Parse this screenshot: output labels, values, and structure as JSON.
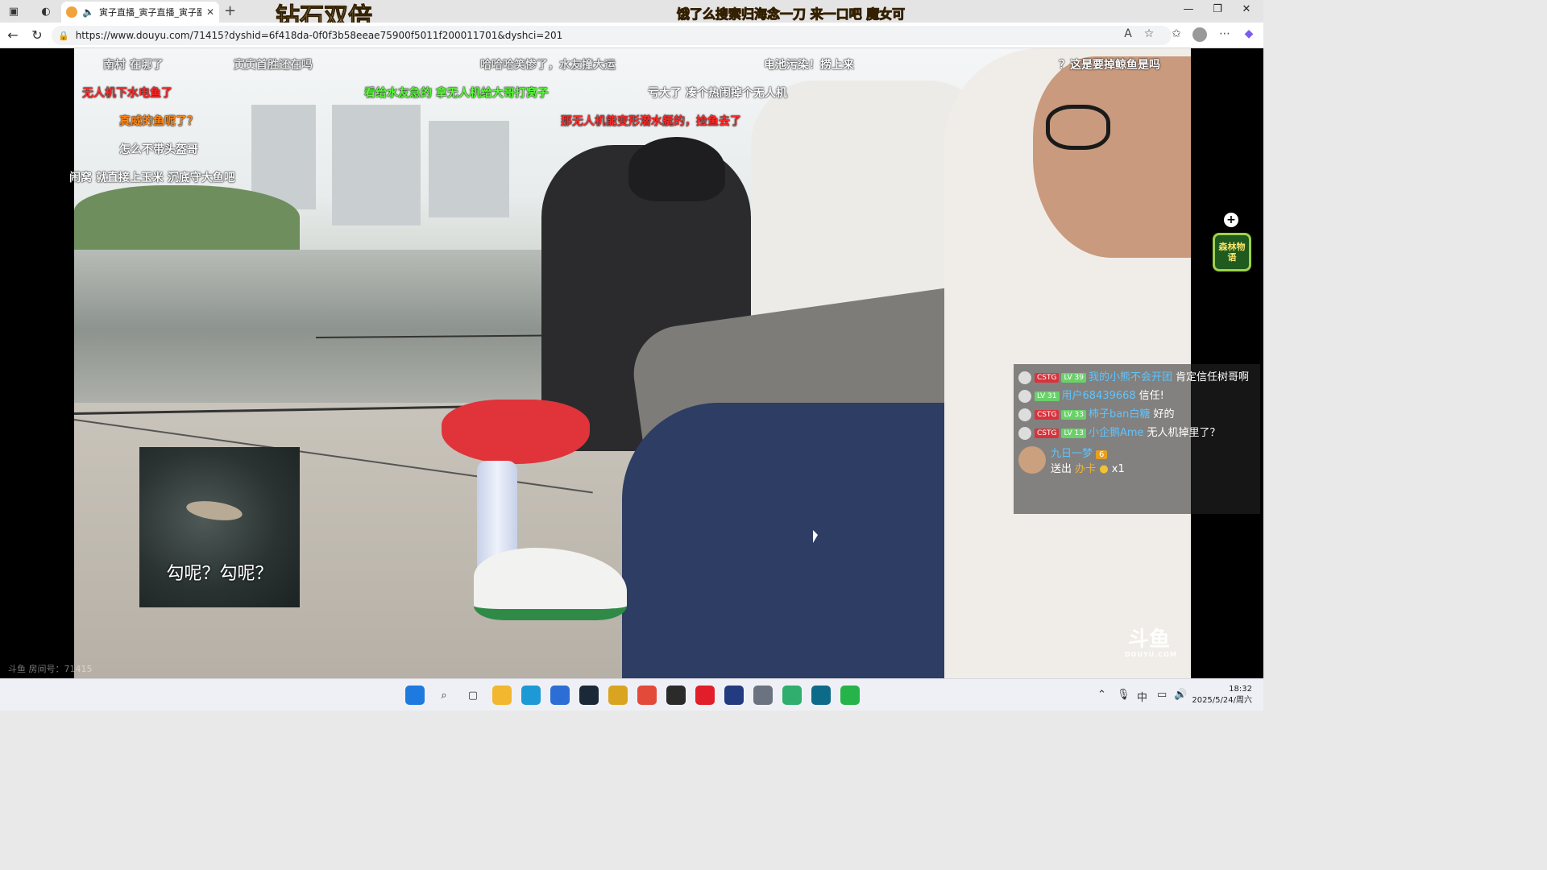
{
  "browser": {
    "tab_title": "寅子直播_寅子直播_寅子鄙",
    "url": "https://www.douyu.com/71415?dyshid=6f418da-0f0f3b58eeae75900f5011f200011701&dyshci=201",
    "overlay_left": "钻石双倍",
    "overlay_right": "饿了么搜索归海念一刀 来一口吧 魔女可"
  },
  "danmaku": [
    {
      "text": "南村 在哪了",
      "color": "#e8e8e8"
    },
    {
      "text": "寅寅首胜还在吗",
      "color": "#e8e8e8"
    },
    {
      "text": "哈哈哈笑惨了，水友撞大运",
      "color": "#e8e8e8"
    },
    {
      "text": "电池污染！捞上来",
      "color": "#ffffff"
    },
    {
      "text": "？这是要掉鲸鱼是吗",
      "color": "#ffffff"
    },
    {
      "text": "无人机下水电鱼了",
      "color": "#ff2a2a"
    },
    {
      "text": "看给水友急的 拿无人机给大哥打窝子",
      "color": "#5cff3a"
    },
    {
      "text": "亏大了 凑个热闹掉个无人机",
      "color": "#ffffff"
    },
    {
      "text": "真威的鱼呢了？",
      "color": "#ff8a1a"
    },
    {
      "text": "那无人机能变形潜水艇的，捡鱼去了",
      "color": "#ff2a2a"
    },
    {
      "text": "怎么不带头盔哥",
      "color": "#ffffff"
    },
    {
      "text": "闹窝 就直接上玉米 沉底守大鱼吧",
      "color": "#ffffff"
    }
  ],
  "inset_caption": "勾呢？勾呢？",
  "forest_badge": "森林物语",
  "chat": {
    "messages": [
      {
        "badges": [
          "CSTG",
          "LV 39"
        ],
        "user": "我的小熊不会开团",
        "text": "肯定信任树哥啊"
      },
      {
        "badges": [
          "LV 31"
        ],
        "user": "用户68439668",
        "text": "信任!"
      },
      {
        "badges": [
          "CSTG",
          "LV 33"
        ],
        "user": "柿子ban白糖",
        "text": "好的"
      },
      {
        "badges": [
          "CSTG",
          "LV 13"
        ],
        "user": "小企鹅Ame",
        "text": "无人机掉里了？"
      }
    ],
    "gift": {
      "user": "九日一梦",
      "level": "6",
      "prefix": "送出",
      "item": "办卡",
      "count": "x1"
    }
  },
  "player": {
    "watermark_big": "斗鱼",
    "watermark_small": "DOUYU.COM",
    "room_label": "斗鱼 房间号：71415"
  },
  "taskbar": {
    "time": "18:32",
    "date": "2025/5/24/周六",
    "ime": "中",
    "apps": [
      {
        "name": "start",
        "color": "#1f7ae0"
      },
      {
        "name": "search",
        "color": "#333333"
      },
      {
        "name": "task-view",
        "color": "#333333"
      },
      {
        "name": "file-explorer",
        "color": "#f2b72e"
      },
      {
        "name": "edge",
        "color": "#1d9ad6"
      },
      {
        "name": "store",
        "color": "#2c6ed5"
      },
      {
        "name": "steam",
        "color": "#1b2838"
      },
      {
        "name": "game-app",
        "color": "#d9a520"
      },
      {
        "name": "app-red",
        "color": "#e34a3a"
      },
      {
        "name": "app-e",
        "color": "#2b2b2b"
      },
      {
        "name": "netease-music",
        "color": "#e11e2a"
      },
      {
        "name": "app-blue",
        "color": "#233b80"
      },
      {
        "name": "settings",
        "color": "#6b7380"
      },
      {
        "name": "app-green",
        "color": "#2fae6e"
      },
      {
        "name": "app-teal",
        "color": "#0d6b8a"
      },
      {
        "name": "wechat",
        "color": "#26b34a"
      }
    ]
  }
}
